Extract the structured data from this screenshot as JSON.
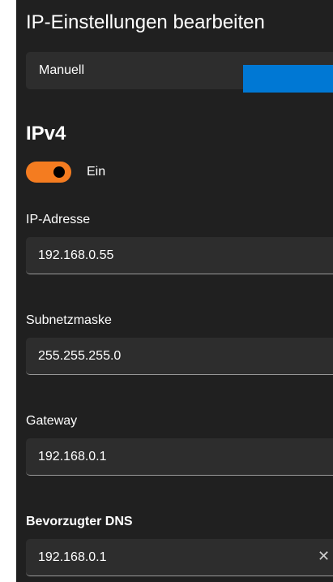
{
  "dialog": {
    "title": "IP-Einstellungen bearbeiten",
    "mode_value": "Manuell"
  },
  "ipv4": {
    "heading": "IPv4",
    "toggle_label": "Ein",
    "toggle_on": true,
    "toggle_color": "#f47c20"
  },
  "fields": {
    "ip_address": {
      "label": "IP-Adresse",
      "value": "192.168.0.55"
    },
    "subnet_mask": {
      "label": "Subnetzmaske",
      "value": "255.255.255.0"
    },
    "gateway": {
      "label": "Gateway",
      "value": "192.168.0.1"
    },
    "preferred_dns": {
      "label": "Bevorzugter DNS",
      "value": "192.168.0.1",
      "clear_glyph": "✕"
    }
  },
  "colors": {
    "panel_bg": "#202020",
    "field_bg": "#2d2d2d",
    "accent": "#0078d4",
    "text": "#ffffff"
  }
}
